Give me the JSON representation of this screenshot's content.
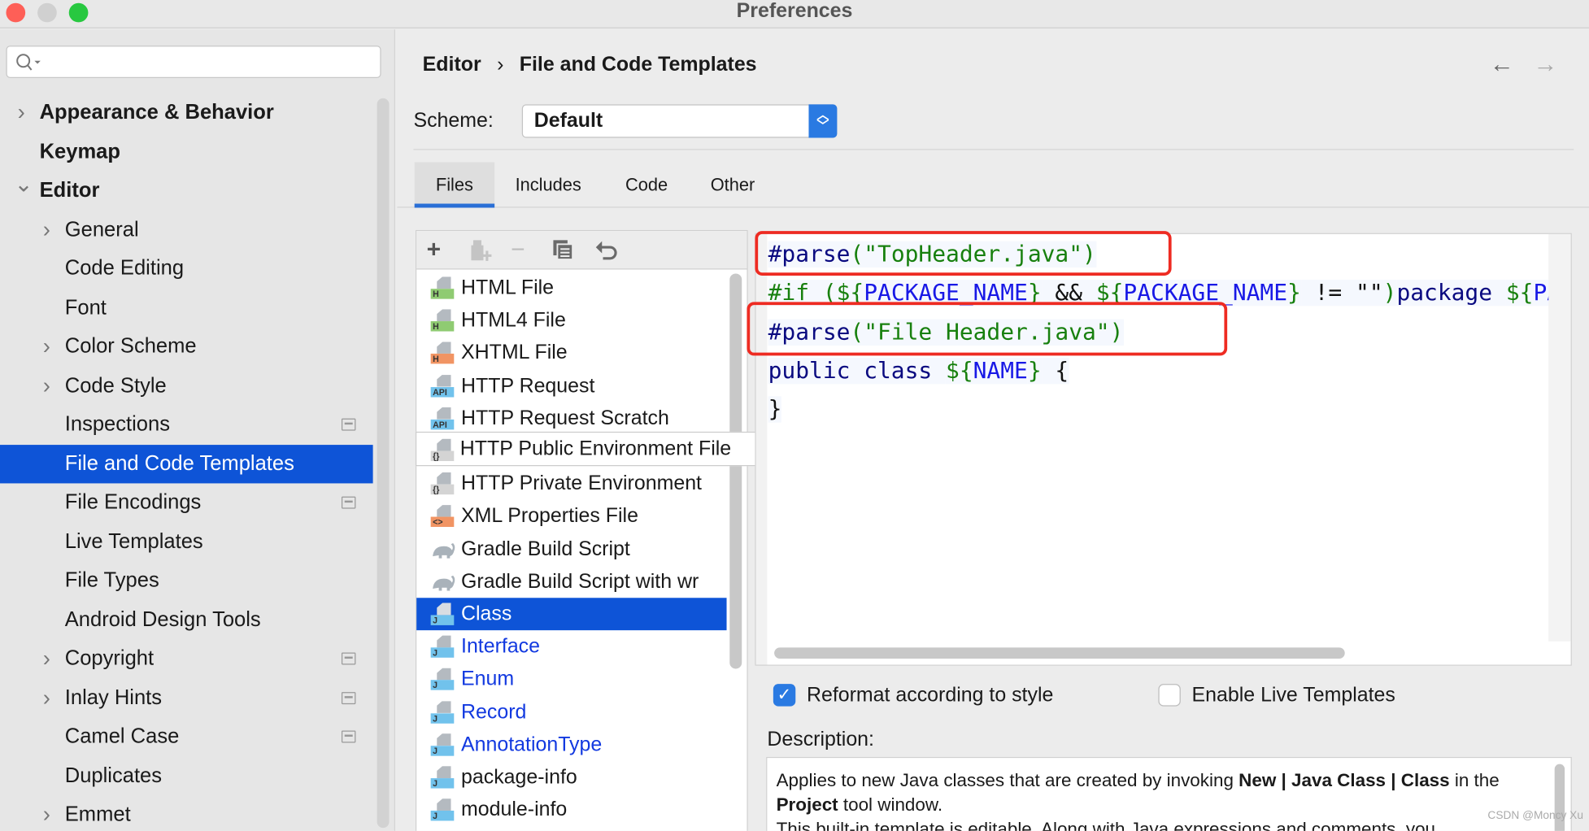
{
  "window": {
    "title": "Preferences"
  },
  "sidebar": {
    "search_placeholder": "",
    "items": [
      {
        "label": "Appearance & Behavior",
        "level": 0,
        "chevron": "right",
        "bold": true
      },
      {
        "label": "Keymap",
        "level": 0,
        "chevron": "",
        "bold": true
      },
      {
        "label": "Editor",
        "level": 0,
        "chevron": "down",
        "bold": true
      },
      {
        "label": "General",
        "level": 1,
        "chevron": "right"
      },
      {
        "label": "Code Editing",
        "level": 1,
        "chevron": ""
      },
      {
        "label": "Font",
        "level": 1,
        "chevron": ""
      },
      {
        "label": "Color Scheme",
        "level": 1,
        "chevron": "right"
      },
      {
        "label": "Code Style",
        "level": 1,
        "chevron": "right"
      },
      {
        "label": "Inspections",
        "level": 1,
        "chevron": "",
        "badge": true
      },
      {
        "label": "File and Code Templates",
        "level": 1,
        "chevron": "",
        "selected": true
      },
      {
        "label": "File Encodings",
        "level": 1,
        "chevron": "",
        "badge": true
      },
      {
        "label": "Live Templates",
        "level": 1,
        "chevron": ""
      },
      {
        "label": "File Types",
        "level": 1,
        "chevron": ""
      },
      {
        "label": "Android Design Tools",
        "level": 1,
        "chevron": ""
      },
      {
        "label": "Copyright",
        "level": 1,
        "chevron": "right",
        "badge": true
      },
      {
        "label": "Inlay Hints",
        "level": 1,
        "chevron": "right",
        "badge": true
      },
      {
        "label": "Camel Case",
        "level": 1,
        "chevron": "",
        "badge": true
      },
      {
        "label": "Duplicates",
        "level": 1,
        "chevron": ""
      },
      {
        "label": "Emmet",
        "level": 1,
        "chevron": "right"
      }
    ]
  },
  "header": {
    "breadcrumb": [
      "Editor",
      "File and Code Templates"
    ],
    "separator": "›",
    "back_icon": "arrow-left-icon",
    "forward_icon": "arrow-right-icon"
  },
  "scheme": {
    "label": "Scheme:",
    "value": "Default"
  },
  "tabs": [
    {
      "label": "Files",
      "active": true
    },
    {
      "label": "Includes"
    },
    {
      "label": "Code"
    },
    {
      "label": "Other"
    }
  ],
  "toolbar": {
    "icons": [
      "plus-icon",
      "copy-add-icon",
      "minus-icon",
      "duplicate-icon",
      "undo-icon"
    ]
  },
  "templates": [
    {
      "label": "HTML File",
      "icon": "H",
      "icon_color": "#8fcb72"
    },
    {
      "label": "HTML4 File",
      "icon": "H",
      "icon_color": "#8fcb72"
    },
    {
      "label": "XHTML File",
      "icon": "H",
      "icon_color": "#f19463"
    },
    {
      "label": "HTTP Request",
      "icon": "API",
      "icon_color": "#71c2ec"
    },
    {
      "label": "HTTP Request Scratch",
      "icon": "API",
      "icon_color": "#71c2ec"
    },
    {
      "label": "HTTP Public Environment File",
      "icon": "{}",
      "icon_color": "#d4d4d4",
      "overflow": true
    },
    {
      "label": "HTTP Private Environment",
      "icon": "{}",
      "icon_color": "#d4d4d4"
    },
    {
      "label": "XML Properties File",
      "icon": "<>",
      "icon_color": "#f19463"
    },
    {
      "label": "Gradle Build Script",
      "icon": "gradle",
      "icon_color": "#a9b2ba"
    },
    {
      "label": "Gradle Build Script with wr",
      "icon": "gradle",
      "icon_color": "#a9b2ba"
    },
    {
      "label": "Class",
      "icon": "J",
      "icon_color": "#71c2ec",
      "selected": true
    },
    {
      "label": "Interface",
      "icon": "J",
      "icon_color": "#71c2ec",
      "modified": true
    },
    {
      "label": "Enum",
      "icon": "J",
      "icon_color": "#71c2ec",
      "modified": true
    },
    {
      "label": "Record",
      "icon": "J",
      "icon_color": "#71c2ec",
      "modified": true
    },
    {
      "label": "AnnotationType",
      "icon": "J",
      "icon_color": "#71c2ec",
      "modified": true
    },
    {
      "label": "package-info",
      "icon": "J",
      "icon_color": "#71c2ec"
    },
    {
      "label": "module-info",
      "icon": "J",
      "icon_color": "#71c2ec"
    }
  ],
  "editor": {
    "lines": [
      [
        {
          "t": "#parse",
          "c": "dir"
        },
        {
          "t": "(\"TopHeader.java\")",
          "c": "str"
        }
      ],
      [
        {
          "t": "#if (${",
          "c": "str"
        },
        {
          "t": "PACKAGE_NAME",
          "c": "var"
        },
        {
          "t": "}",
          "c": "str"
        },
        {
          "t": " && ",
          "c": "plain"
        },
        {
          "t": "${",
          "c": "str"
        },
        {
          "t": "PACKAGE_NAME",
          "c": "var"
        },
        {
          "t": "}",
          "c": "str"
        },
        {
          "t": " != \"\"",
          "c": "plain"
        },
        {
          "t": ")",
          "c": "str"
        },
        {
          "t": "package ",
          "c": "dir"
        },
        {
          "t": "${",
          "c": "str"
        },
        {
          "t": "PA",
          "c": "var"
        }
      ],
      [
        {
          "t": "#parse",
          "c": "dir"
        },
        {
          "t": "(\"File Header.java\")",
          "c": "str"
        }
      ],
      [
        {
          "t": "public class ",
          "c": "dir"
        },
        {
          "t": "${",
          "c": "str"
        },
        {
          "t": "NAME",
          "c": "var"
        },
        {
          "t": "}",
          "c": "str"
        },
        {
          "t": " {",
          "c": "plain"
        }
      ],
      [
        {
          "t": "}",
          "c": "plain"
        }
      ]
    ],
    "highlight_color": "#ee2b22"
  },
  "options": {
    "reformat": {
      "label": "Reformat according to style",
      "checked": true
    },
    "live_templates": {
      "label": "Enable Live Templates",
      "checked": false
    }
  },
  "description": {
    "label": "Description:",
    "parts": [
      {
        "t": "Applies to new Java classes that are created by invoking "
      },
      {
        "t": "New | Java Class | Class",
        "b": true
      },
      {
        "t": " in the "
      },
      {
        "t": "Project",
        "b": true
      },
      {
        "t": " tool window."
      },
      {
        "t": "\nThis built-in template is editable. Along with Java expressions and comments, you"
      }
    ]
  },
  "watermark": "CSDN @Moncy Xu",
  "colors": {
    "accent": "#0e54d7",
    "modified_text": "#1239e0",
    "checkbox": "#2a7ae2"
  }
}
